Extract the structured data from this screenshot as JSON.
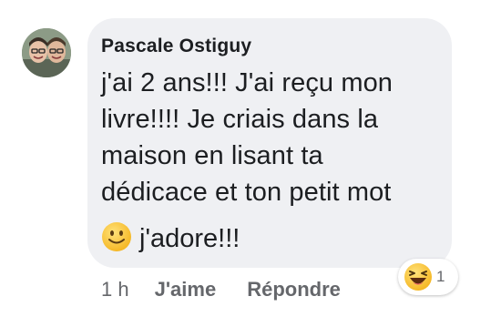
{
  "comment": {
    "author": "Pascale Ostiguy",
    "lines": [
      "j'ai 2 ans!!! J'ai reçu mon",
      "livre!!!! Je criais dans la",
      "maison en lisant ta",
      "dédicace et ton petit mot"
    ],
    "emoji_icon": "slightly-smiling-face-icon",
    "final_text": "j'adore!!!"
  },
  "actions": {
    "time": "1 h",
    "like_label": "J'aime",
    "reply_label": "Répondre"
  },
  "reaction": {
    "icon": "laughing-face-icon",
    "count": "1"
  },
  "colors": {
    "bubble": "#eff0f3",
    "text": "#1c1e21",
    "secondary": "#65676b",
    "emoji_yellow": "#f7c52c"
  }
}
